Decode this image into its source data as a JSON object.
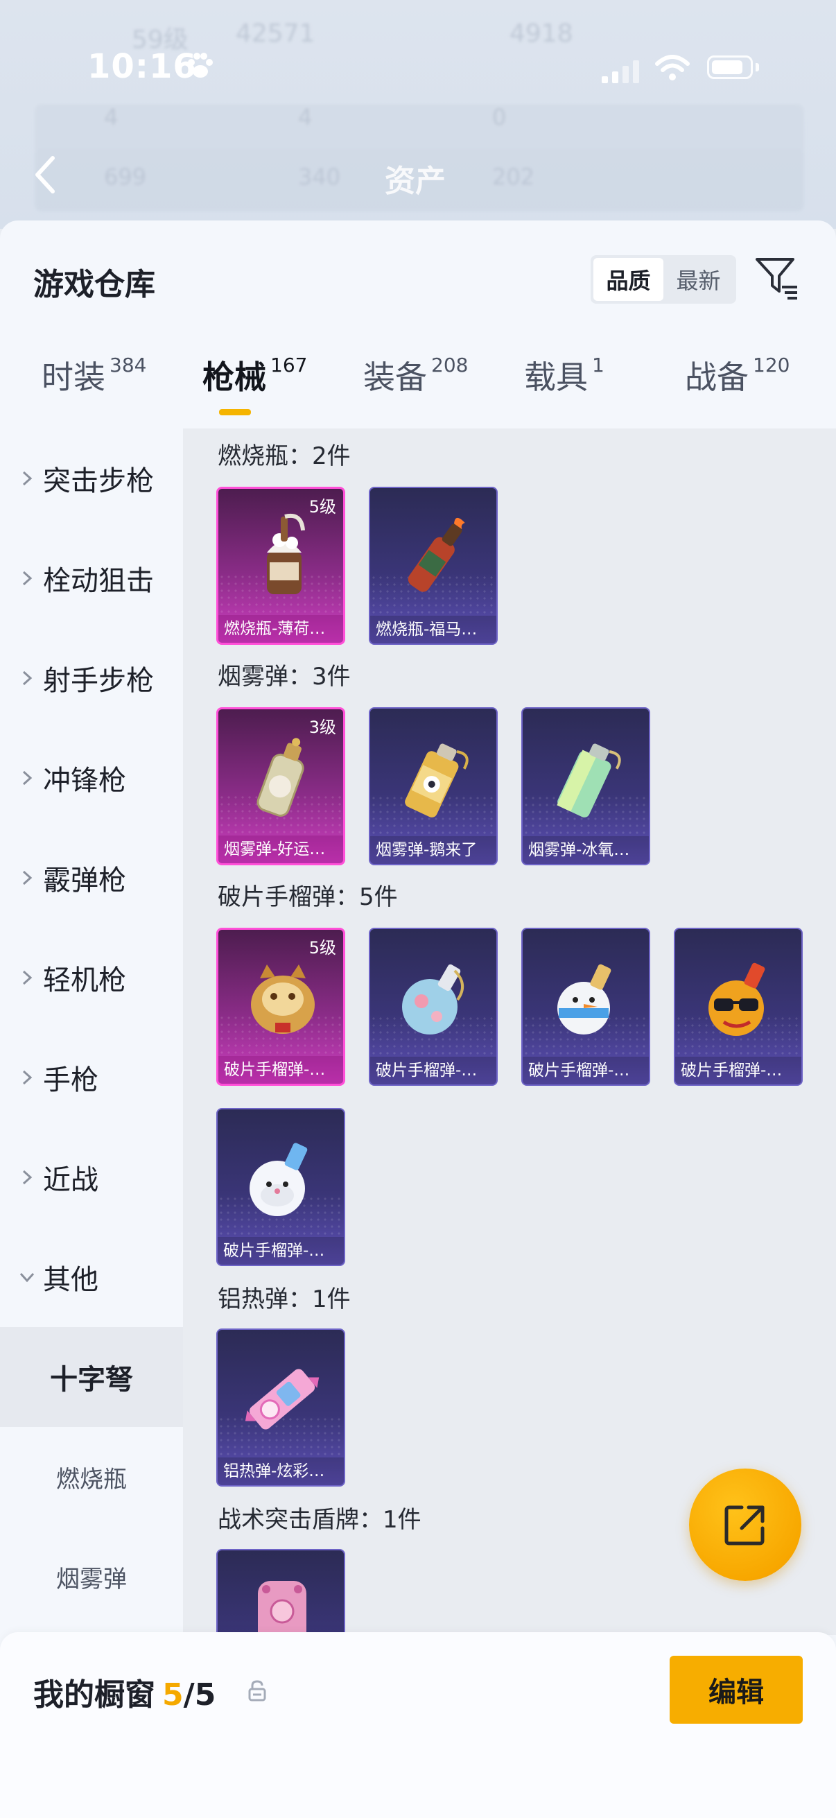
{
  "status_bar": {
    "time": "10:16"
  },
  "background_header": {
    "title": "资产",
    "ghost_top": [
      "59级",
      "42571",
      "4918"
    ],
    "ghost_stats_row1": [
      "4",
      "4",
      "0"
    ],
    "ghost_stats_row2": [
      "699",
      "340",
      "202"
    ]
  },
  "sheet": {
    "title": "游戏仓库",
    "sort_options": [
      {
        "label": "品质",
        "active": true
      },
      {
        "label": "最新",
        "active": false
      }
    ]
  },
  "tabs": [
    {
      "label": "时装",
      "count": "384",
      "active": false
    },
    {
      "label": "枪械",
      "count": "167",
      "active": true
    },
    {
      "label": "装备",
      "count": "208",
      "active": false
    },
    {
      "label": "载具",
      "count": "1",
      "active": false
    },
    {
      "label": "战备",
      "count": "120",
      "active": false
    }
  ],
  "sidebar": {
    "items": [
      {
        "label": "突击步枪"
      },
      {
        "label": "栓动狙击"
      },
      {
        "label": "射手步枪"
      },
      {
        "label": "冲锋枪"
      },
      {
        "label": "霰弹枪"
      },
      {
        "label": "轻机枪"
      },
      {
        "label": "手枪"
      },
      {
        "label": "近战"
      },
      {
        "label": "其他"
      }
    ],
    "sub_items": [
      {
        "label": "十字弩",
        "selected": true
      },
      {
        "label": "燃烧瓶",
        "selected": false
      },
      {
        "label": "烟雾弹",
        "selected": false
      }
    ]
  },
  "sections": [
    {
      "title": "燃烧瓶：2件",
      "items": [
        {
          "name": "燃烧瓶-薄荷…",
          "level": "5级",
          "rarity": "pink",
          "icon": "ice-cream-bottle"
        },
        {
          "name": "燃烧瓶-福马…",
          "level": "",
          "rarity": "purple",
          "icon": "molotov-bottle"
        }
      ]
    },
    {
      "title": "烟雾弹：3件",
      "items": [
        {
          "name": "烟雾弹-好运…",
          "level": "3级",
          "rarity": "pink",
          "icon": "lucky-bottle"
        },
        {
          "name": "烟雾弹-鹅来了",
          "level": "",
          "rarity": "purple",
          "icon": "goose-canister"
        },
        {
          "name": "烟雾弹-冰氧…",
          "level": "",
          "rarity": "purple",
          "icon": "ice-canister"
        }
      ]
    },
    {
      "title": "破片手榴弹：5件",
      "items": [
        {
          "name": "破片手榴弹-…",
          "level": "5级",
          "rarity": "pink",
          "icon": "golden-cat-grenade"
        },
        {
          "name": "破片手榴弹-…",
          "level": "",
          "rarity": "purple",
          "icon": "blue-floral-grenade"
        },
        {
          "name": "破片手榴弹-…",
          "level": "",
          "rarity": "purple",
          "icon": "snowman-grenade"
        },
        {
          "name": "破片手榴弹-…",
          "level": "",
          "rarity": "purple",
          "icon": "sunglasses-grenade"
        },
        {
          "name": "破片手榴弹-…",
          "level": "",
          "rarity": "purple",
          "icon": "seal-grenade"
        }
      ]
    },
    {
      "title": "铝热弹：1件",
      "items": [
        {
          "name": "铝热弹-炫彩…",
          "level": "",
          "rarity": "purple",
          "icon": "candy-thermite"
        }
      ]
    },
    {
      "title": "战术突击盾牌：1件",
      "items": [
        {
          "name": "",
          "level": "",
          "rarity": "purple",
          "icon": "pink-shield"
        }
      ]
    }
  ],
  "showcase": {
    "label": "我的橱窗",
    "current": "5",
    "separator": "/",
    "max": "5",
    "edit_label": "编辑"
  },
  "colors": {
    "accent": "#f5b400",
    "pink_rarity": "#ff4fd8",
    "purple_rarity": "#6d63c6"
  }
}
